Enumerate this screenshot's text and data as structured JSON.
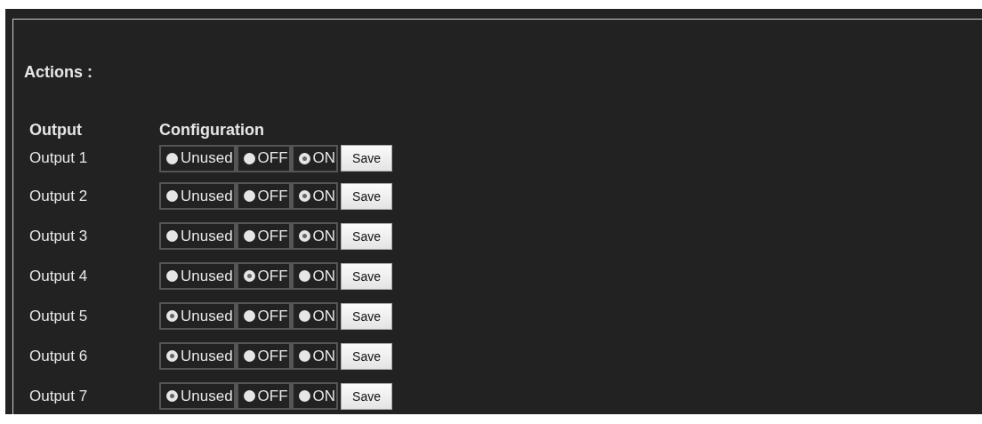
{
  "section_title": "Actions :",
  "columns": [
    "Output",
    "Configuration"
  ],
  "outputs": [
    {
      "label": "Output 1",
      "options": [
        {
          "label": "Unused",
          "selected": false
        },
        {
          "label": "OFF",
          "selected": false
        },
        {
          "label": "ON",
          "selected": true
        }
      ],
      "button": "Save"
    },
    {
      "label": "Output 2",
      "options": [
        {
          "label": "Unused",
          "selected": false
        },
        {
          "label": "OFF",
          "selected": false
        },
        {
          "label": "ON",
          "selected": true
        }
      ],
      "button": "Save"
    },
    {
      "label": "Output 3",
      "options": [
        {
          "label": "Unused",
          "selected": false
        },
        {
          "label": "OFF",
          "selected": false
        },
        {
          "label": "ON",
          "selected": true
        }
      ],
      "button": "Save"
    },
    {
      "label": "Output 4",
      "options": [
        {
          "label": "Unused",
          "selected": false
        },
        {
          "label": "OFF",
          "selected": true
        },
        {
          "label": "ON",
          "selected": false
        }
      ],
      "button": "Save"
    },
    {
      "label": "Output 5",
      "options": [
        {
          "label": "Unused",
          "selected": true
        },
        {
          "label": "OFF",
          "selected": false
        },
        {
          "label": "ON",
          "selected": false
        }
      ],
      "button": "Save"
    },
    {
      "label": "Output 6",
      "options": [
        {
          "label": "Unused",
          "selected": true
        },
        {
          "label": "OFF",
          "selected": false
        },
        {
          "label": "ON",
          "selected": false
        }
      ],
      "button": "Save"
    },
    {
      "label": "Output 7",
      "options": [
        {
          "label": "Unused",
          "selected": true
        },
        {
          "label": "OFF",
          "selected": false
        },
        {
          "label": "ON",
          "selected": false
        }
      ],
      "button": "Save"
    }
  ]
}
